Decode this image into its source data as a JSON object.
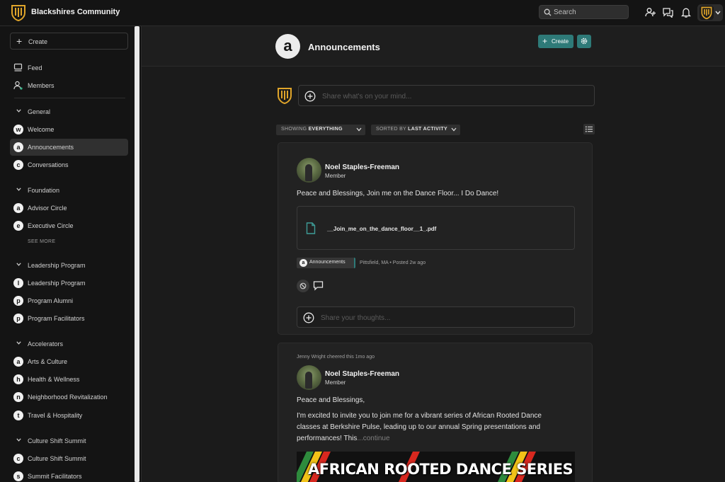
{
  "app": {
    "title": "Blackshires Community"
  },
  "topbar": {
    "search_placeholder": "Search"
  },
  "sidebar": {
    "create_label": "Create",
    "feed_label": "Feed",
    "members_label": "Members",
    "see_more": "SEE MORE",
    "groups": [
      {
        "label": "General"
      },
      {
        "label": "Foundation"
      },
      {
        "label": "Leadership Program"
      },
      {
        "label": "Accelerators"
      },
      {
        "label": "Culture Shift Summit"
      }
    ],
    "channels": [
      {
        "letter": "w",
        "label": "Welcome"
      },
      {
        "letter": "a",
        "label": "Announcements"
      },
      {
        "letter": "c",
        "label": "Conversations"
      },
      {
        "letter": "a",
        "label": "Advisor Circle"
      },
      {
        "letter": "e",
        "label": "Executive Circle"
      },
      {
        "letter": "l",
        "label": "Leadership Program"
      },
      {
        "letter": "p",
        "label": "Program Alumni"
      },
      {
        "letter": "p",
        "label": "Program Facilitators"
      },
      {
        "letter": "a",
        "label": "Arts & Culture"
      },
      {
        "letter": "h",
        "label": "Health & Wellness"
      },
      {
        "letter": "n",
        "label": "Neighborhood Revitalization"
      },
      {
        "letter": "t",
        "label": "Travel & Hospitality"
      },
      {
        "letter": "c",
        "label": "Culture Shift Summit"
      },
      {
        "letter": "s",
        "label": "Summit Facilitators"
      }
    ]
  },
  "channel": {
    "letter": "a",
    "title": "Announcements",
    "create_label": "Create"
  },
  "composer": {
    "placeholder": "Share what's on your mind..."
  },
  "filters": {
    "showing_prefix": "SHOWING",
    "showing_value": "EVERYTHING",
    "sorted_prefix": "SORTED BY",
    "sorted_value": "LAST ACTIVITY"
  },
  "posts": [
    {
      "author": "Noel Staples-Freeman",
      "role": "Member",
      "text": "Peace and Blessings, Join me on the Dance Floor... I Do Dance!",
      "attachment": "__Join_me_on_the_dance_floor__1_.pdf",
      "channel_letter": "a",
      "channel_chip": "Announcements",
      "meta": "Pittsfield, MA •   Posted 2w ago",
      "reply_placeholder": "Share your thoughts..."
    },
    {
      "cheered": "Jenny Wright cheered this 1mo ago",
      "author": "Noel Staples-Freeman",
      "role": "Member",
      "line1": "Peace and Blessings,",
      "line2": "I'm excited to invite you to join me for a vibrant series of African Rooted Dance",
      "line3": "classes at Berkshire Pulse, leading up to our annual Spring presentations and",
      "line4": "performances! This",
      "continue": "...continue",
      "banner": "AFRICAN ROOTED DANCE SERIES"
    }
  ],
  "colors": {
    "accent": "#2e7a78",
    "logo_gold": "#e0a52a",
    "background": "#1b1b1b"
  }
}
